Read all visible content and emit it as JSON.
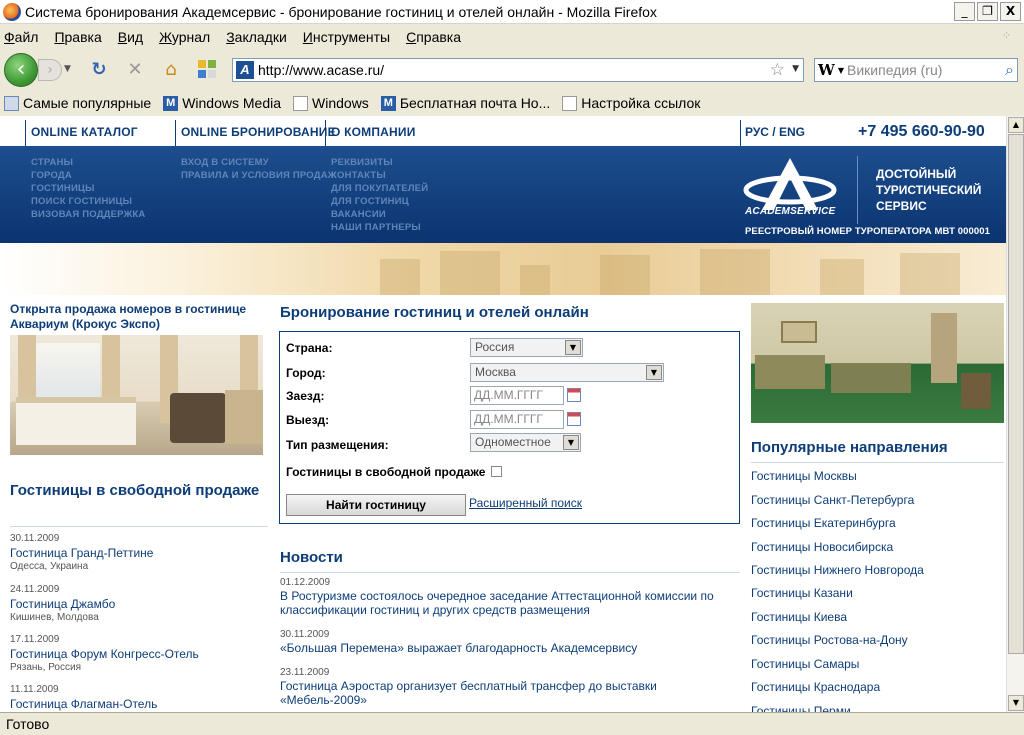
{
  "window": {
    "title": "Система бронирования Академсервис - бронирование гостиниц и отелей онлайн - Mozilla Firefox",
    "minimize": "_",
    "restore": "❐",
    "close": "X"
  },
  "menu": [
    "Файл",
    "Правка",
    "Вид",
    "Журнал",
    "Закладки",
    "Инструменты",
    "Справка"
  ],
  "toolbar": {
    "url": "http://www.acase.ru/",
    "search_placeholder": "Википедия (ru)",
    "search_engine": "W"
  },
  "bookmarks": [
    "Самые популярные",
    "Windows Media",
    "Windows",
    "Бесплатная почта Но...",
    "Настройка ссылок"
  ],
  "site": {
    "top_nav": [
      "ONLINE КАТАЛОГ",
      "ONLINE БРОНИРОВАНИЕ",
      "О КОМПАНИИ"
    ],
    "lang": "РУС / ENG",
    "phone": "+7 495 660-90-90",
    "submenu": {
      "catalog": [
        "СТРАНЫ",
        "ГОРОДА",
        "ГОСТИНИЦЫ",
        "ПОИСК ГОСТИНИЦЫ",
        "ВИЗОВАЯ ПОДДЕРЖКА"
      ],
      "booking": [
        "ВХОД В СИСТЕМУ",
        "ПРАВИЛА И УСЛОВИЯ ПРОДАЖ"
      ],
      "company": [
        "РЕКВИЗИТЫ",
        "КОНТАКТЫ",
        "ДЛЯ ПОКУПАТЕЛЕЙ",
        "ДЛЯ ГОСТИНИЦ",
        "ВАКАНСИИ",
        "НАШИ ПАРТНЕРЫ"
      ]
    },
    "logo_name": "ACADEMSERVICE",
    "slogan": [
      "ДОСТОЙНЫЙ",
      "ТУРИСТИЧЕСКИЙ",
      "СЕРВИС"
    ],
    "registry": "РЕЕСТРОВЫЙ НОМЕР ТУРОПЕРАТОРА МВТ 000001"
  },
  "promo": {
    "title": "Открыта продажа номеров в гостинице Аквариум (Крокус Экспо)"
  },
  "free_sale": {
    "heading": "Гостиницы в свободной продаже",
    "items": [
      {
        "date": "30.11.2009",
        "name": "Гостиница Гранд-Петтине",
        "city": "Одесса, Украина"
      },
      {
        "date": "24.11.2009",
        "name": "Гостиница Джамбо",
        "city": "Кишинев, Молдова"
      },
      {
        "date": "17.11.2009",
        "name": "Гостиница Форум Конгресс-Отель",
        "city": "Рязань, Россия"
      },
      {
        "date": "11.11.2009",
        "name": "Гостиница Флагман-Отель",
        "city": ""
      }
    ]
  },
  "booking": {
    "heading": "Бронирование гостиниц и отелей онлайн",
    "country_label": "Страна:",
    "country_value": "Россия",
    "city_label": "Город:",
    "city_value": "Москва",
    "checkin_label": "Заезд:",
    "checkin_placeholder": "ДД.ММ.ГГГГ",
    "checkout_label": "Выезд:",
    "checkout_placeholder": "ДД.ММ.ГГГГ",
    "room_label": "Тип размещения:",
    "room_value": "Одноместное",
    "free_label": "Гостиницы в свободной продаже",
    "find_button": "Найти гостиницу",
    "advanced_link": "Расширенный поиск"
  },
  "news": {
    "heading": "Новости",
    "items": [
      {
        "date": "01.12.2009",
        "text": "В Ростуризме состоялось очередное заседание Аттестационной комиссии по классификации гостиниц и других средств размещения"
      },
      {
        "date": "30.11.2009",
        "text": "«Большая Перемена» выражает благодарность Академсервису"
      },
      {
        "date": "23.11.2009",
        "text": "Гостиница Аэростар организует бесплатный трансфер до выставки «Мебель-2009»"
      }
    ]
  },
  "popular": {
    "heading": "Популярные направления",
    "items": [
      "Гостиницы Москвы",
      "Гостиницы Санкт-Петербурга",
      "Гостиницы Екатеринбурга",
      "Гостиницы Новосибирска",
      "Гостиницы Нижнего Новгорода",
      "Гостиницы Казани",
      "Гостиницы Киева",
      "Гостиницы Ростова-на-Дону",
      "Гостиницы Самары",
      "Гостиницы Краснодара",
      "Гостиницы Перми"
    ]
  },
  "status": "Готово"
}
